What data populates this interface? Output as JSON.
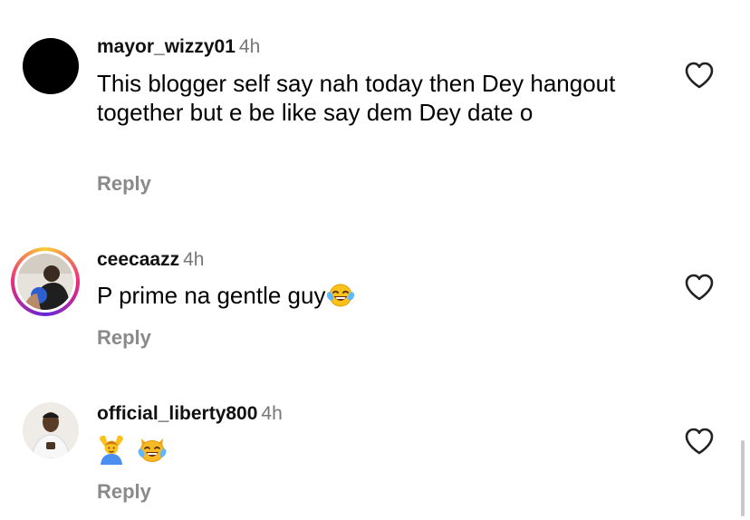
{
  "comments": [
    {
      "username": "mayor_wizzy01",
      "time": "4h",
      "text": "This blogger self say nah today then Dey hangout together but e be like say dem Dey date o",
      "reply_label": "Reply",
      "avatar": "black-circle",
      "emojis": []
    },
    {
      "username": "ceecaazz",
      "time": "4h",
      "text": "P prime na gentle guy",
      "reply_label": "Reply",
      "avatar": "story-ring-photo",
      "emojis": [
        "face-with-tears-of-joy"
      ]
    },
    {
      "username": "official_liberty800",
      "time": "4h",
      "text": "",
      "reply_label": "Reply",
      "avatar": "photo",
      "emojis": [
        "person-gesturing-ok",
        "cat-with-tears-of-joy"
      ]
    }
  ],
  "icons": {
    "like": "heart-outline-icon"
  },
  "colors": {
    "username": "#111111",
    "time": "#777777",
    "reply": "#8a8a8a",
    "story_ring": "#ee2a7b"
  }
}
